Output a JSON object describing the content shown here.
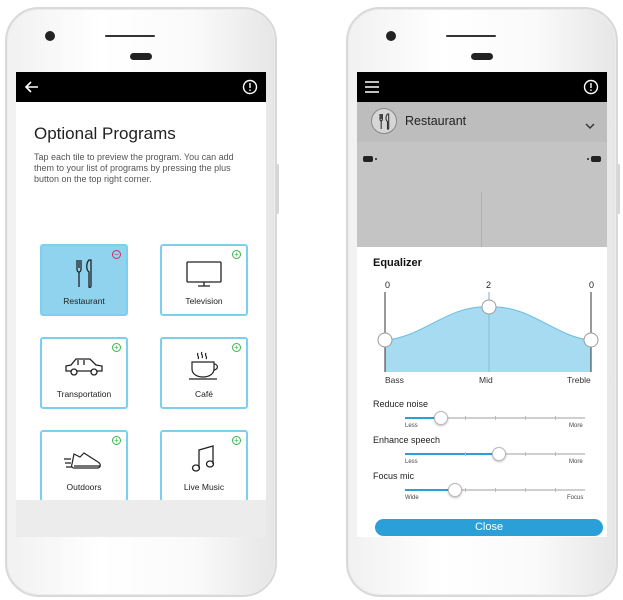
{
  "left_screen": {
    "page_title": "Optional Programs",
    "description": "Tap each tile to preview the program. You can add them to your list of programs by pressing the plus button on the top right corner.",
    "tiles": [
      {
        "label": "Restaurant",
        "icon": "fork-knife-icon",
        "status": "added",
        "badge": "−"
      },
      {
        "label": "Television",
        "icon": "television-icon",
        "status": "available",
        "badge": "+"
      },
      {
        "label": "Transportation",
        "icon": "car-icon",
        "status": "available",
        "badge": "+"
      },
      {
        "label": "Café",
        "icon": "coffee-cup-icon",
        "status": "available",
        "badge": "+"
      },
      {
        "label": "Outdoors",
        "icon": "sneaker-icon",
        "status": "available",
        "badge": "+"
      },
      {
        "label": "Live Music",
        "icon": "music-note-icon",
        "status": "available",
        "badge": "+"
      }
    ]
  },
  "right_screen": {
    "program": {
      "name": "Restaurant",
      "icon": "fork-knife-icon"
    },
    "equalizer": {
      "title": "Equalizer",
      "bands": [
        {
          "label": "Bass",
          "value": "0"
        },
        {
          "label": "Mid",
          "value": "2"
        },
        {
          "label": "Treble",
          "value": "0"
        }
      ]
    },
    "sliders": [
      {
        "title": "Reduce noise",
        "min_label": "Less",
        "max_label": "More",
        "level": 0.2
      },
      {
        "title": "Enhance speech",
        "min_label": "Less",
        "max_label": "More",
        "level": 0.52
      },
      {
        "title": "Focus mic",
        "min_label": "Wide",
        "max_label": "Focus",
        "level": 0.28
      }
    ],
    "close_label": "Close"
  },
  "colors": {
    "accent": "#2a9fd8",
    "tile_border": "#7cd0ee",
    "tile_selected": "#8fd3ee",
    "add_badge": "#39b54a",
    "remove_badge": "#e0245e",
    "eq_fill": "#a7dbf2"
  }
}
